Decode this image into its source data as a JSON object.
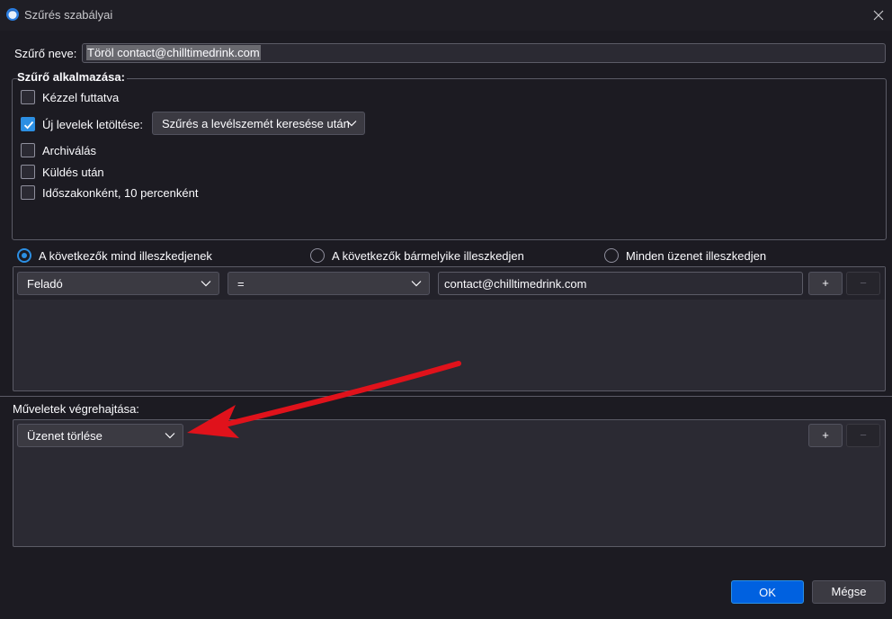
{
  "window": {
    "title": "Szűrés szabályai",
    "app_icon": "thunderbird-icon",
    "close_icon": "close-icon"
  },
  "filter_name": {
    "label": "Szűrő neve:",
    "value": "Töröl contact@chilltimedrink.com"
  },
  "apply": {
    "legend": "Szűrő alkalmazása:",
    "options": [
      {
        "label": "Kézzel futtatva",
        "checked": false
      },
      {
        "label": "Új levelek letöltése:",
        "checked": true
      },
      {
        "label": "Archiválás",
        "checked": false
      },
      {
        "label": "Küldés után",
        "checked": false
      },
      {
        "label": "Időszakonként, 10 percenként",
        "checked": false
      }
    ],
    "new_mail_dropdown": "Szűrés a levélszemét keresése után"
  },
  "match": {
    "options": [
      {
        "label": "A következők mind illeszkedjenek",
        "selected": true
      },
      {
        "label": "A következők bármelyike illeszkedjen",
        "selected": false
      },
      {
        "label": "Minden üzenet illeszkedjen",
        "selected": false
      }
    ]
  },
  "rule": {
    "field": "Feladó",
    "operator": "=",
    "value": "contact@chilltimedrink.com",
    "add_label": "+",
    "remove_label": "−"
  },
  "actions": {
    "label": "Műveletek végrehajtása:",
    "action": "Üzenet törlése",
    "add_label": "+",
    "remove_label": "−"
  },
  "footer": {
    "ok_label": "OK",
    "cancel_label": "Mégse"
  },
  "colors": {
    "background": "#1c1b22",
    "accent": "#2c8fe3",
    "ok_button": "#0061e0",
    "annotation_arrow": "#e0121b"
  }
}
